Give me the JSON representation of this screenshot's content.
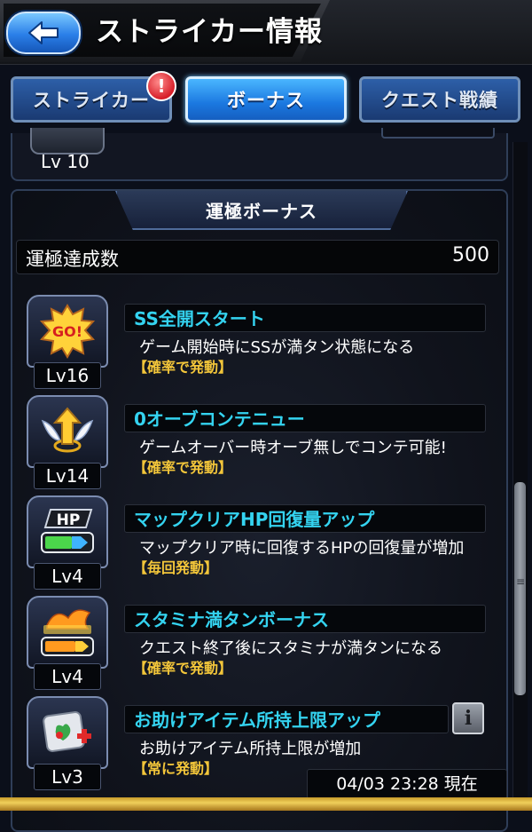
{
  "header": {
    "title": "ストライカー情報"
  },
  "tabs": [
    {
      "label": "ストライカー",
      "active": false,
      "alert": "!"
    },
    {
      "label": "ボーナス",
      "active": true
    },
    {
      "label": "クエスト戦績",
      "active": false
    }
  ],
  "upper_panel": {
    "level": "Lv 10"
  },
  "luck_bonus": {
    "section_title": "運極ボーナス",
    "count_label": "運極達成数",
    "count_value": "500",
    "items": [
      {
        "icon": "go-burst-icon",
        "level": "Lv16",
        "name": "SS全開スタート",
        "description": "ゲーム開始時にSSが満タン状態になる",
        "trigger": "【確率で発動】"
      },
      {
        "icon": "winged-arrow-icon",
        "level": "Lv14",
        "name": "0オーブコンテニュー",
        "description": "ゲームオーバー時オーブ無しでコンテ可能!",
        "trigger": "【確率で発動】"
      },
      {
        "icon": "hp-gauge-icon",
        "level": "Lv4",
        "name": "マップクリアHP回復量アップ",
        "description": "マップクリア時に回復するHPの回復量が増加",
        "trigger": "【毎回発動】"
      },
      {
        "icon": "stamina-gauge-icon",
        "level": "Lv4",
        "name": "スタミナ満タンボーナス",
        "description": "クエスト終了後にスタミナが満タンになる",
        "trigger": "【確率で発動】"
      },
      {
        "icon": "item-box-icon",
        "level": "Lv3",
        "name": "お助けアイテム所持上限アップ",
        "description": "お助けアイテム所持上限が増加",
        "trigger": "【常に発動】"
      }
    ]
  },
  "info_button_icon": "info-icon",
  "timestamp": "04/03 23:28 現在",
  "colors": {
    "bonus_name": "#34d3f0",
    "trigger": "#f3c63a",
    "tab_active": "#1b78e0",
    "tab_inactive": "#1a3a72",
    "alert": "#d71f2a"
  }
}
